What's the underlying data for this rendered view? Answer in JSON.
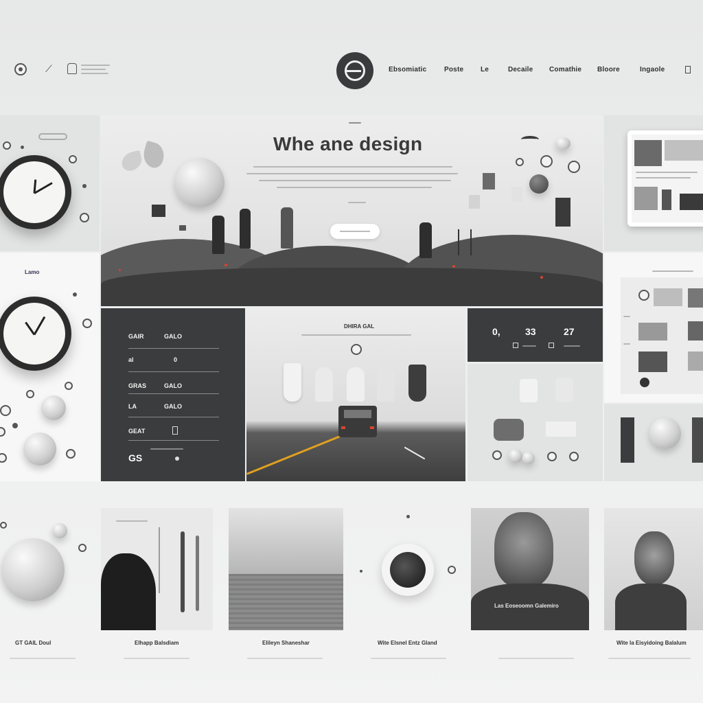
{
  "header": {
    "nav": [
      "Ebsomiatic",
      "Poste",
      "Le",
      "Decaile",
      "Comathie",
      "Bloore",
      "Ingaole"
    ]
  },
  "hero": {
    "title": "Whe ane design"
  },
  "left_panel": {
    "label": "Lamo"
  },
  "stats": {
    "values": [
      "0,",
      "33",
      "27"
    ]
  },
  "stats_rows": {
    "rows": [
      {
        "left": "GAIR",
        "right": "GALO"
      },
      {
        "left": "al",
        "right": "0"
      },
      {
        "left": "GRAS",
        "right": "GALO"
      },
      {
        "left": "LA",
        "right": "GALO"
      },
      {
        "left": "GEAT",
        "right": ""
      }
    ],
    "footer": "GS"
  },
  "road_panel": {
    "heading": "DHIRA GAL"
  },
  "cards": [
    {
      "caption": "GT GAIL Doul"
    },
    {
      "caption": "Elhapp Balsdiam"
    },
    {
      "caption": "Elileyn Shaneshar"
    },
    {
      "caption": "Wite Elsnel Entz Gland"
    },
    {
      "caption": "Las Eoseoomn Galemiro"
    },
    {
      "caption": "Wite la Eisyidoing Balalum"
    }
  ],
  "colors": {
    "dark_panel": "#3b3c3d",
    "accent": "#d9442f",
    "road_line": "#e0a020"
  }
}
